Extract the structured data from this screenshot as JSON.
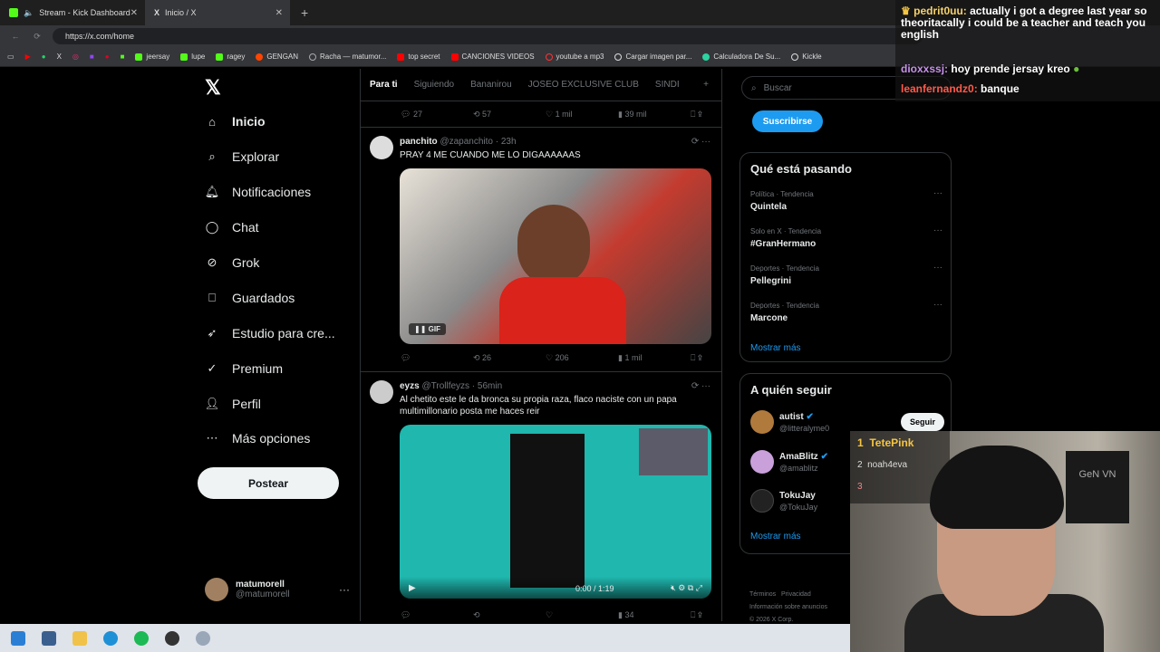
{
  "browser": {
    "tabs": [
      {
        "title": "Stream - Kick Dashboard",
        "active": false
      },
      {
        "title": "Inicio / X",
        "active": true
      }
    ],
    "url": "https://x.com/home",
    "bookmarks": [
      "jeersay",
      "lupe",
      "ragey",
      "GENGAN",
      "Racha — matumor...",
      "top secret",
      "CANCIONES VIDEOS",
      "youtube a mp3",
      "Cargar imagen par...",
      "Calculadora De Su...",
      "Kickle"
    ]
  },
  "nav": {
    "items": [
      {
        "label": "Inicio",
        "icon": "home-icon"
      },
      {
        "label": "Explorar",
        "icon": "search-icon"
      },
      {
        "label": "Notificaciones",
        "icon": "bell-icon"
      },
      {
        "label": "Chat",
        "icon": "chat-icon"
      },
      {
        "label": "Grok",
        "icon": "grok-icon"
      },
      {
        "label": "Guardados",
        "icon": "bookmark-icon"
      },
      {
        "label": "Estudio para cre...",
        "icon": "rocket-icon"
      },
      {
        "label": "Premium",
        "icon": "verified-icon"
      },
      {
        "label": "Perfil",
        "icon": "person-icon"
      },
      {
        "label": "Más opciones",
        "icon": "more-circle-icon"
      }
    ],
    "post_button": "Postear",
    "account": {
      "name": "matumorell",
      "handle": "@matumorell"
    }
  },
  "feed": {
    "tabs": [
      "Para ti",
      "Siguiendo",
      "Bananirou",
      "JOSEO EXCLUSIVE CLUB",
      "SINDI"
    ],
    "top_actions": {
      "replies": "27",
      "reposts": "57",
      "likes": "1 mil",
      "views": "39 mil"
    },
    "posts": [
      {
        "name": "panchito",
        "handle": "@zapanchito · 23h",
        "text": "PRAY 4 ME CUANDO ME LO DIGAAAAAAS",
        "media_badge": "GIF",
        "actions": {
          "replies": "",
          "reposts": "26",
          "likes": "206",
          "views": "1 mil"
        }
      },
      {
        "name": "eyzs",
        "handle": "@Trollfeyzs · 56min",
        "text": "Al chetito este le da bronca su propia raza, flaco naciste con un papa multimillonario posta me haces reir",
        "video_time": "0:00 / 1:19",
        "actions": {
          "replies": "",
          "reposts": "",
          "likes": "",
          "views": "34"
        }
      }
    ]
  },
  "sidebar": {
    "search_placeholder": "Buscar",
    "subscribe": "Suscribirse",
    "trends_title": "Qué está pasando",
    "trends": [
      {
        "category": "Política · Tendencia",
        "title": "Quintela"
      },
      {
        "category": "Solo en X · Tendencia",
        "title": "#GranHermano"
      },
      {
        "category": "Deportes · Tendencia",
        "title": "Pellegrini"
      },
      {
        "category": "Deportes · Tendencia",
        "title": "Marcone"
      }
    ],
    "show_more": "Mostrar más",
    "follow_title": "A quién seguir",
    "follow": [
      {
        "name": "autist",
        "handle": "@litteralyme0",
        "button": "Seguir"
      },
      {
        "name": "AmaBlitz",
        "handle": "@amablitz"
      },
      {
        "name": "TokuJay",
        "handle": "@TokuJay"
      }
    ],
    "footer": [
      "Términos",
      "Privacidad",
      "Información sobre anuncios",
      "© 2026 X Corp."
    ]
  },
  "stream_chat": [
    {
      "user": "pedrit0uu:",
      "message": "actually i got a degree last year so theoritacally i could be a teacher and teach you english"
    },
    {
      "user": "dioxxssj:",
      "message": "hoy prende jersay kreo"
    },
    {
      "user": "leanfernandz0:",
      "message": "banque"
    }
  ],
  "leaderboard": [
    {
      "rank": "1",
      "name": "TetePink"
    },
    {
      "rank": "2",
      "name": "noah4eva"
    },
    {
      "rank": "3",
      "name": ""
    }
  ],
  "webcam_shirt": "GeN VN",
  "colors": {
    "accent": "#1d9bf0",
    "background": "#000000",
    "border": "#2f3336"
  }
}
